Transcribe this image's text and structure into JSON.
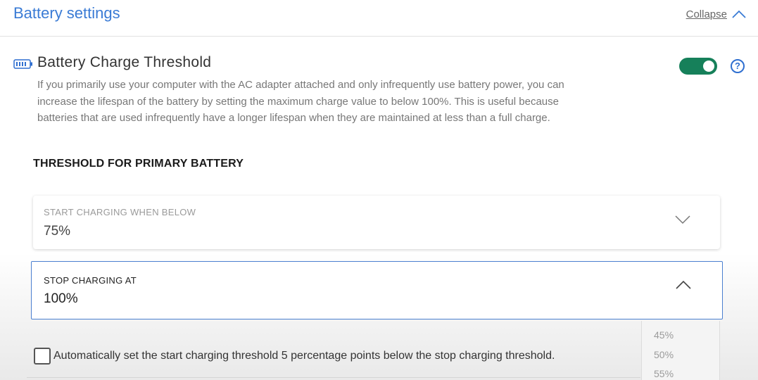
{
  "header": {
    "title": "Battery settings",
    "collapse_label": "Collapse"
  },
  "section": {
    "icon": "battery-icon",
    "title": "Battery Charge Threshold",
    "toggle_on": true,
    "toggle_color": "#16805a",
    "help_symbol": "?",
    "description": "If you primarily use your computer with the AC adapter attached and only infrequently use battery power, you can increase the lifespan of the battery by setting the maximum charge value to below 100%. This is useful because batteries that are used infrequently have a longer lifespan when they are maintained at less than a full charge."
  },
  "threshold": {
    "heading": "THRESHOLD FOR PRIMARY BATTERY",
    "start": {
      "label": "START CHARGING WHEN BELOW",
      "value": "75%"
    },
    "stop": {
      "label": "STOP CHARGING AT",
      "value": "100%",
      "expanded": true,
      "options": [
        "45%",
        "50%",
        "55%"
      ]
    },
    "auto": {
      "checked": false,
      "label": "Automatically set the start charging threshold 5 percentage points below the stop charging threshold."
    }
  },
  "colors": {
    "accent": "#3a7bd5",
    "focus_border": "#4a7fd0",
    "toggle": "#16805a"
  }
}
